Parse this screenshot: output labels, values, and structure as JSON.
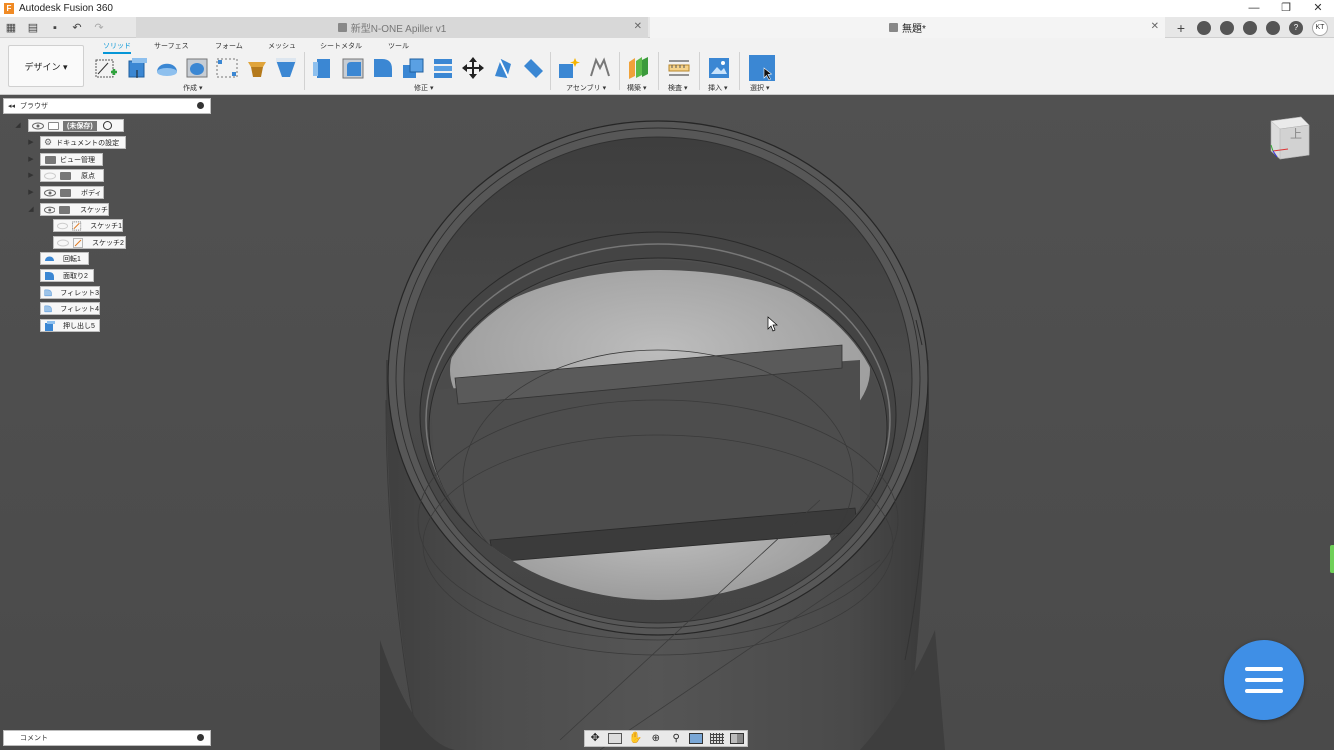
{
  "app": {
    "title": "Autodesk Fusion 360",
    "logo_letter": "F"
  },
  "window_controls": {
    "minimize": "—",
    "restore": "❐",
    "close": "✕"
  },
  "tabs": [
    {
      "label": "新型N-ONE Apiller v1",
      "active": false
    },
    {
      "label": "無題*",
      "active": true
    }
  ],
  "user": {
    "initials": "KT"
  },
  "toolbar": {
    "workspace": "デザイン ▾",
    "ws_tabs": [
      "ソリッド",
      "サーフェス",
      "フォーム",
      "メッシュ",
      "シートメタル",
      "ツール"
    ],
    "groups": {
      "create": "作成 ▾",
      "modify": "修正 ▾",
      "assemble": "アセンブリ ▾",
      "construct": "構築 ▾",
      "inspect": "検査 ▾",
      "insert": "挿入 ▾",
      "select": "選択 ▾"
    }
  },
  "browser": {
    "title": "ブラウザ",
    "collapse_glyph": "◂◂",
    "root": "(未保存)",
    "items": [
      "ドキュメントの設定",
      "ビュー管理",
      "原点",
      "ボディ",
      "スケッチ",
      "スケッチ1",
      "スケッチ2",
      "回転1",
      "面取り2",
      "フィレット3",
      "フィレット4",
      "押し出し5"
    ]
  },
  "viewcube": {
    "face": "上"
  },
  "comments": {
    "label": "コメント"
  },
  "colors": {
    "accent": "#0696d7",
    "fab": "#3f8fe6",
    "viewport": "#4d4d4d"
  }
}
